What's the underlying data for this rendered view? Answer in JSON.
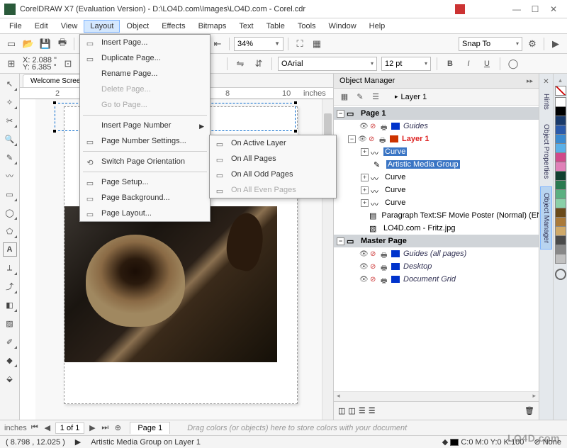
{
  "title": "CorelDRAW X7 (Evaluation Version) - D:\\LO4D.com\\Images\\LO4D.com - Corel.cdr",
  "menus": [
    "File",
    "Edit",
    "View",
    "Layout",
    "Object",
    "Effects",
    "Bitmaps",
    "Text",
    "Table",
    "Tools",
    "Window",
    "Help"
  ],
  "active_menu_index": 3,
  "toolbar": {
    "zoom": "34%",
    "snap_to": "Snap To"
  },
  "propbar": {
    "x_label": "X:",
    "x": "2.088 \"",
    "y_label": "Y:",
    "y": "6.385 \"",
    "font": "Arial",
    "font_size": "12 pt"
  },
  "tabs": {
    "welcome": "Welcome Screen",
    "ruler_marks": [
      "2",
      "8",
      "10"
    ],
    "ruler_unit": "inches"
  },
  "layout_menu": {
    "items": [
      {
        "label": "Insert Page...",
        "icon": "▭"
      },
      {
        "label": "Duplicate Page...",
        "icon": "▭"
      },
      {
        "label": "Rename Page...",
        "icon": ""
      },
      {
        "label": "Delete Page...",
        "icon": "",
        "disabled": true
      },
      {
        "label": "Go to Page...",
        "icon": "",
        "disabled": true
      },
      {
        "sep": true
      },
      {
        "label": "Insert Page Number",
        "icon": "",
        "submenu": true
      },
      {
        "label": "Page Number Settings...",
        "icon": "▭"
      },
      {
        "sep": true
      },
      {
        "label": "Switch Page Orientation",
        "icon": "⟲"
      },
      {
        "sep": true
      },
      {
        "label": "Page Setup...",
        "icon": "▭"
      },
      {
        "label": "Page Background...",
        "icon": "▭"
      },
      {
        "label": "Page Layout...",
        "icon": "▭"
      }
    ]
  },
  "page_number_submenu": [
    {
      "label": "On Active Layer"
    },
    {
      "label": "On All Pages"
    },
    {
      "label": "On All Odd Pages"
    },
    {
      "label": "On All Even Pages",
      "disabled": true
    }
  ],
  "panel": {
    "title": "Object Manager",
    "layer_label": "Layer 1",
    "tree": {
      "page1": "Page 1",
      "guides": "Guides",
      "layer1": "Layer 1",
      "curve_sel": "Curve",
      "amg": "Artistic Media Group",
      "curve2": "Curve",
      "curve3": "Curve",
      "curve4": "Curve",
      "ptext": "Paragraph Text:SF Movie Poster (Normal) (EN",
      "bitmap": "LO4D.com - Fritz.jpg",
      "master": "Master Page",
      "guides_all": "Guides (all pages)",
      "desktop": "Desktop",
      "docgrid": "Document Grid"
    }
  },
  "right_tabs": [
    "Hints",
    "Object Properties",
    "Object Manager"
  ],
  "swatches": [
    "#ffffff",
    "#000000",
    "#1a3a6a",
    "#2a5aaa",
    "#3a8ad0",
    "#5ab0e8",
    "#d04a8a",
    "#e080b8",
    "#104030",
    "#2a7a50",
    "#5ab080",
    "#8ad0a8",
    "#6a4a1a",
    "#aa7a3a",
    "#d0aa6a",
    "#4a4a4a",
    "#888888",
    "#c0c0c0"
  ],
  "page_nav": {
    "pos": "1 of 1",
    "page_tab": "Page 1",
    "ruler_unit": "inches",
    "hint": "Drag colors (or objects) here to store colors with your document"
  },
  "status": {
    "cursor": "( 8.798 , 12.025 )",
    "selection": "Artistic Media Group on Layer 1",
    "fill": "C:0 M:0 Y:0 K:100",
    "outline": "None"
  }
}
